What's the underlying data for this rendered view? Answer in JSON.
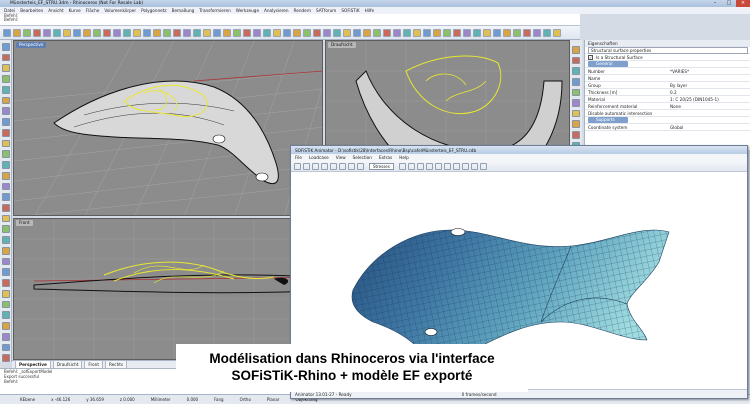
{
  "rhino": {
    "title": "Münsterteis_EF_STRU.3dm - Rhinoceros (Not For Resale Lab)",
    "menu": [
      "Datei",
      "Bearbeiten",
      "Ansicht",
      "Kurve",
      "Fläche",
      "Volumenkörper",
      "Polygonnetz",
      "Bemaßung",
      "Transformieren",
      "Werkzeuge",
      "Analysieren",
      "Rendern",
      "SATforum",
      "SOFiSTiK",
      "Hilfe"
    ],
    "command_lines": [
      "Befehl:",
      "Befehl:"
    ],
    "viewports": {
      "perspective": "Perspective",
      "draufsicht": "Draufsicht",
      "front": "Front",
      "right": "Rechts"
    },
    "tabs": [
      "Perspective",
      "Draufsicht",
      "Front",
      "Rechts"
    ],
    "history": [
      "Befehl: _sofExportModel",
      "Export successful",
      "Befehl:"
    ],
    "status": [
      "KEbene",
      "x -46.126",
      "y 36.659",
      "z 0.000",
      "Millimeter",
      "0.000",
      "Fang",
      "Ortho",
      "Planar",
      "Objektfang"
    ]
  },
  "properties": {
    "header": "Eigenschaften",
    "selector": "Structural surface properties",
    "checkbox_label": "Is a Structural Surface",
    "group_general": "General",
    "rows": [
      {
        "k": "Number",
        "v": "*VARIES*"
      },
      {
        "k": "Name",
        "v": ""
      },
      {
        "k": "Group",
        "v": "By layer"
      },
      {
        "k": "Thickness [m]",
        "v": "0.2"
      },
      {
        "k": "Material",
        "v": "1: C 20/25 (DIN1045-1)"
      },
      {
        "k": "Reinforcement material",
        "v": "None"
      },
      {
        "k": "Disable automatic intersection",
        "v": ""
      }
    ],
    "group_supports": "Supports",
    "coord_row": {
      "k": "Coordinate system",
      "v": "Global"
    }
  },
  "sofistik": {
    "title": "SOFiSTiK Animator - D:\\sofistik\\28\\Interfaces\\Rhino\\Bsp\\cafe\\Münsterteis_EF_STRU.cdb",
    "menu": [
      "File",
      "Loadcase",
      "View",
      "Selection",
      "Extras",
      "Help"
    ],
    "select_value": "Stresses",
    "status_left": "Animator 13.01-27 - Ready",
    "status_right": "0 frames/second"
  },
  "caption": {
    "line1": "Modélisation dans Rhinoceros via l'interface",
    "line2": "SOFiSTiK-Rhino + modèle EF exporté"
  },
  "colors": {
    "viewport_bg": "#8c8c8c",
    "curve_yellow": "#e8e830",
    "shell_blue": "#3f77a4",
    "shell_light": "#8fd0d8"
  }
}
